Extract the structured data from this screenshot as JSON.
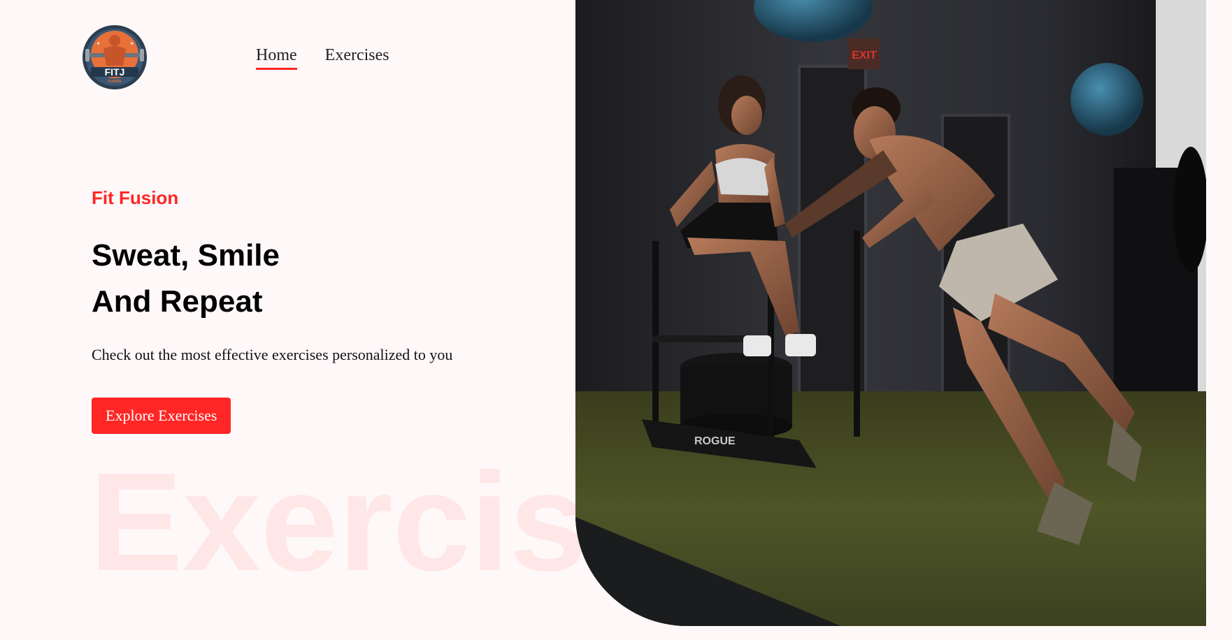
{
  "logo": {
    "text": "FITJ",
    "subtext": "FUSION",
    "icon": "bodybuilder-dumbbell-icon"
  },
  "nav": {
    "items": [
      {
        "label": "Home",
        "active": true
      },
      {
        "label": "Exercises",
        "active": false
      }
    ]
  },
  "hero": {
    "brand": "Fit Fusion",
    "headline_line1": "Sweat, Smile",
    "headline_line2": "And Repeat",
    "subtext": "Check out the most effective exercises personalized to you",
    "cta_label": "Explore Exercises"
  },
  "watermark": "Exercis",
  "hero_image": {
    "subject": "gym-photo-two-athletes-sled",
    "sign_text": "EXIT",
    "equipment_brand": "ROGUE"
  },
  "colors": {
    "accent": "#ff2625",
    "background": "#fff8f9",
    "text": "#000000"
  }
}
